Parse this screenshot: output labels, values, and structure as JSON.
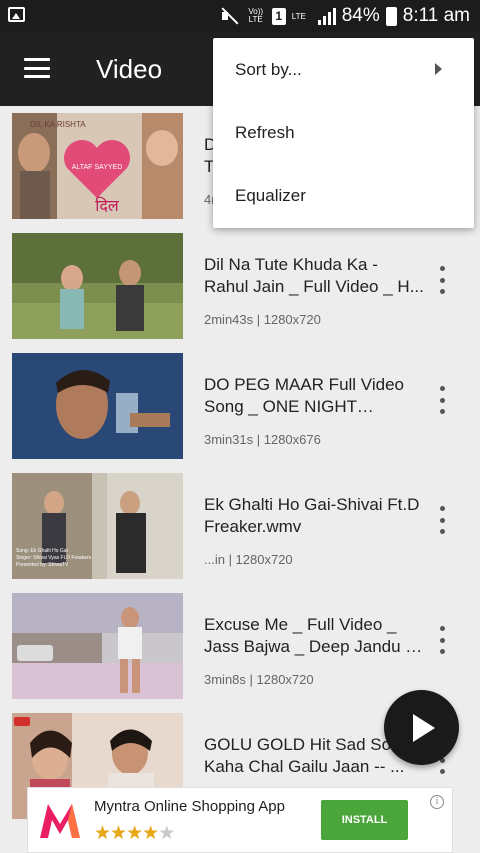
{
  "status_bar": {
    "volte_label": "Vo)) LTE",
    "sim_label": "1",
    "lte_label": "LTE",
    "battery_percent": "84%",
    "time": "8:11 am"
  },
  "app_bar": {
    "title": "Video",
    "menu_icon": "hamburger-icon"
  },
  "overflow_menu": {
    "items": [
      {
        "label": "Sort by...",
        "has_submenu": true
      },
      {
        "label": "Refresh"
      },
      {
        "label": "Equalizer"
      }
    ]
  },
  "videos": [
    {
      "title": "D... T...",
      "title_l1": "D",
      "title_l2": "T",
      "meta": "4r"
    },
    {
      "title": "Dil Na Tute Khuda Ka - Rahul Jain _ Full Video _ H...",
      "meta": "2min43s  |  1280x720"
    },
    {
      "title": "DO PEG MAAR Full Video Song _ ONE NIGHT STAND...",
      "meta": "3min31s  |  1280x676"
    },
    {
      "title": "Ek Ghalti Ho Gai-Shivai Ft.D Freaker.wmv",
      "meta": "...in  |  1280x720"
    },
    {
      "title": "Excuse Me _ Full Video _ Jass Bajwa _ Deep Jandu _ ...",
      "meta": "3min8s  |  1280x720"
    },
    {
      "title": "GOLU GOLD Hit Sad Son -- Kaha Chal Gailu Jaan -- ...",
      "meta": ""
    }
  ],
  "thumb_text": {
    "t1_top": "DIL KA RISHTA",
    "t1_heart": "ALTAF SAYYED",
    "t1_logo": "दिल",
    "t4_caption1": "Song: Ek Ghalti Ho Gai",
    "t4_caption2": "Singer: Shivai Vyas Ft.D Freakers",
    "t4_caption3": "Presented by: ShivaiTV"
  },
  "ad": {
    "title": "Myntra Online Shopping App",
    "rating": 4,
    "max_rating": 5,
    "install_label": "INSTALL",
    "info_label": "i",
    "brand_color": "#e91e63",
    "button_color": "#4aa63a"
  },
  "colors": {
    "app_bar": "#212121",
    "background": "#ededed",
    "fab": "#1a1a1a"
  }
}
